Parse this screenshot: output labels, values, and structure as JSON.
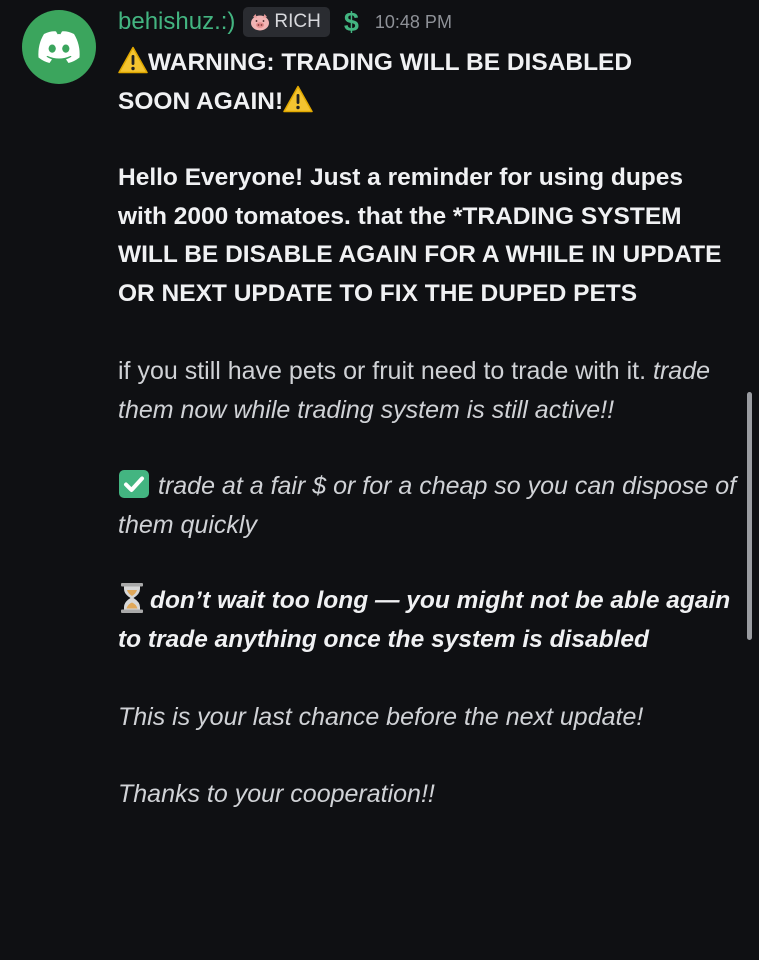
{
  "message": {
    "author": "behishuz.:)",
    "role_tag": "RICH",
    "role_icon": "pig-face-icon",
    "badge": "$",
    "timestamp": "10:48 PM",
    "avatar_icon": "discord-logo-icon",
    "colors": {
      "background": "#0f1013",
      "username": "#43b581",
      "avatar_bg": "#3ba55d"
    },
    "warning_title_line1": "WARNING: TRADING WILL BE DISABLED",
    "warning_title_line2": "SOON AGAIN!",
    "greeting": "Hello Everyone! Just a reminder for using dupes with 2000 tomatoes. that the *TRADING SYSTEM WILL BE DISABLE AGAIN FOR A WHILE IN UPDATE OR NEXT UPDATE TO FIX THE DUPED PETS",
    "reminder_plain": "if you still have pets or fruit need to trade with it.",
    "reminder_italic": "trade them now while trading system is still active!!",
    "tip": "trade at a fair $ or for a cheap so you can dispose of them quickly",
    "urgent": "don’t wait too long — you might not be able again to trade anything once the system is disabled",
    "last_chance": "This is your last chance before the next update!",
    "thanks": "Thanks to your cooperation!!"
  }
}
